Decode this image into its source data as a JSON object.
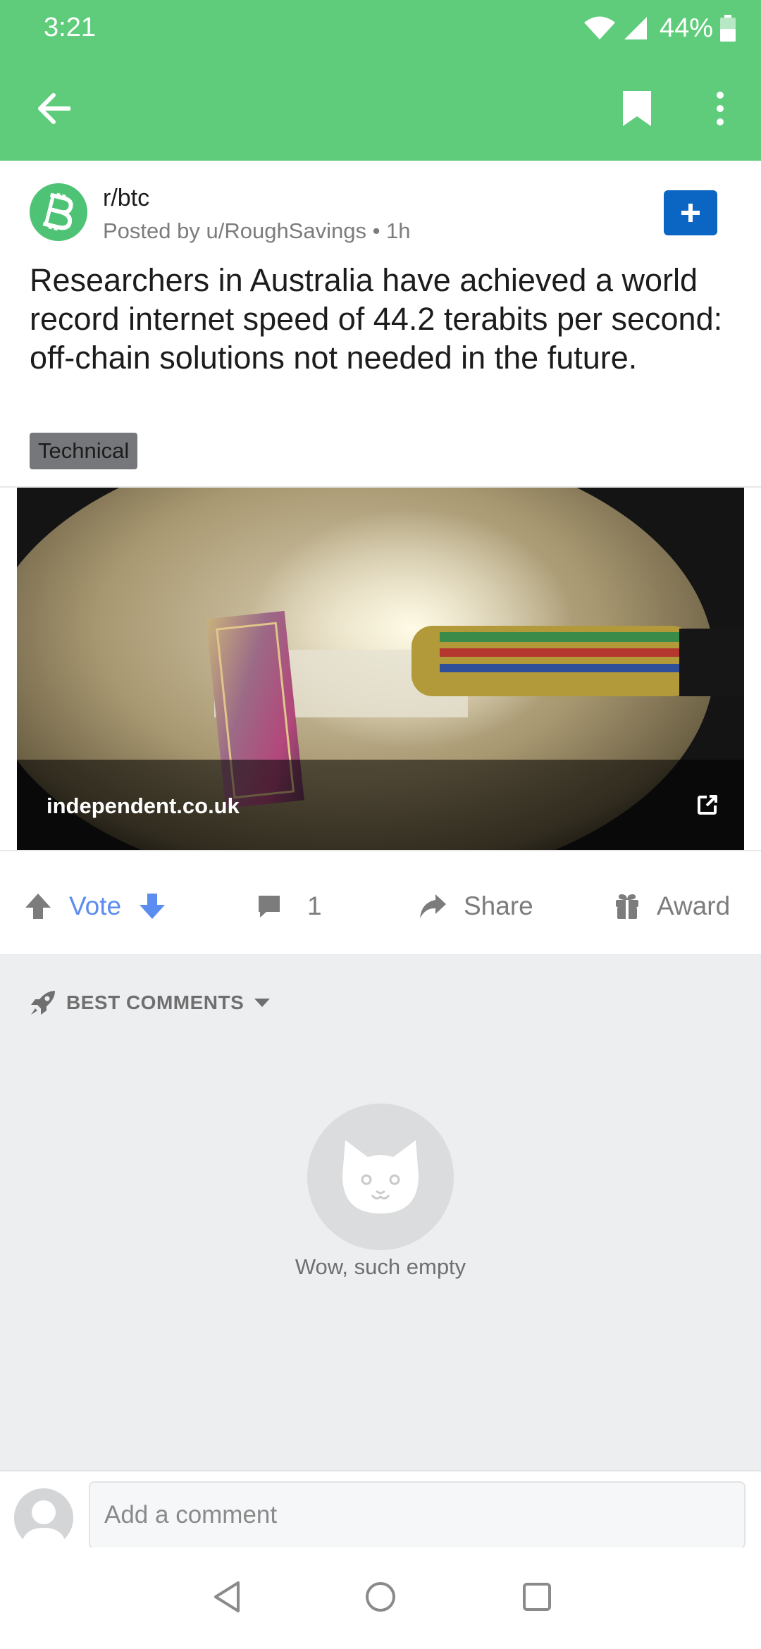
{
  "status_bar": {
    "time": "3:21",
    "battery": "44%"
  },
  "app_bar": {
    "back_icon": "arrow-left-icon",
    "bookmark_icon": "bookmark-icon",
    "more_icon": "more-vertical-icon"
  },
  "post": {
    "subreddit": "r/btc",
    "posted_by": "Posted by u/RoughSavings • 1h",
    "title": "Researchers in Australia have achieved a world record internet speed of 44.2 terabits per second: off-chain solutions not needed in the future.",
    "flair": "Technical",
    "link_domain": "independent.co.uk"
  },
  "actions": {
    "vote_label": "Vote",
    "comment_count": "1",
    "share_label": "Share",
    "award_label": "Award"
  },
  "comments": {
    "sort_label": "BEST COMMENTS",
    "empty_text": "Wow, such empty"
  },
  "composer": {
    "placeholder": "Add a comment"
  },
  "colors": {
    "app_bar": "#5ecc7b",
    "join_button": "#0a66c2",
    "vote_accent": "#5b8cf0",
    "comments_bg": "#edeef0"
  }
}
